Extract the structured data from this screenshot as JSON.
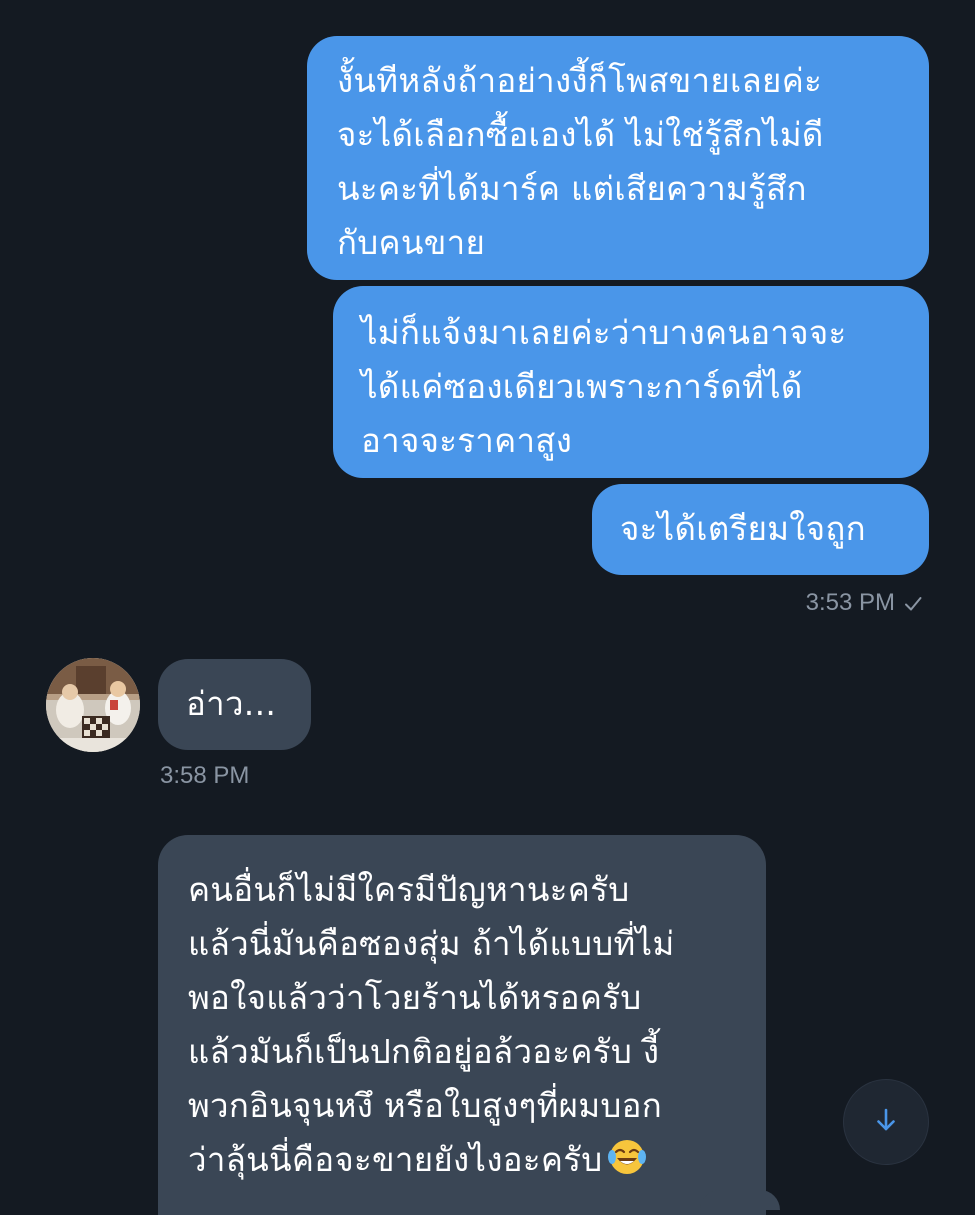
{
  "messages": [
    {
      "direction": "outgoing",
      "lines": [
        "งั้นทีหลังถ้าอย่างงี้ก็โพสขายเลยค่ะ",
        "จะได้เลือกซื้อเองได้ ไม่ใช่รู้สึกไม่ดี",
        "นะคะที่ได้มาร์ค แต่เสียความรู้สึก",
        "กับคนขาย"
      ]
    },
    {
      "direction": "outgoing",
      "lines": [
        "ไม่ก็แจ้งมาเลยค่ะว่าบางคนอาจจะ",
        "ได้แค่ซองเดียวเพราะการ์ดที่ได้",
        "อาจจะราคาสูง"
      ]
    },
    {
      "direction": "outgoing",
      "lines": [
        "จะได้เตรียมใจถูก"
      ]
    },
    {
      "direction": "incoming",
      "lines": [
        "อ่าว..."
      ]
    },
    {
      "direction": "incoming",
      "lines": [
        "คนอื่นก็ไม่มีใครมีปัญหานะครับ",
        "แล้วนี่มันคือซองสุ่ม ถ้าได้แบบที่ไม่",
        "พอใจแล้วว่าโวยร้านได้หรอครับ",
        "แล้วมันก็เป็นปกติอยู่อล้วอะครับ งี้",
        "พวกอินจุนหงึ หรือใบสูงๆที่ผมบอก",
        "ว่าลุ้นนี่คือจะขายยังไงอะครับ"
      ],
      "trailing_emoji": "face-with-tears-of-joy"
    }
  ],
  "timestamps": {
    "outgoing_group": "3:53 PM",
    "incoming_group": "3:58 PM"
  },
  "status": {
    "read_receipt": "check-icon"
  },
  "controls": {
    "scroll_down_icon": "arrow-down-icon"
  },
  "colors": {
    "background": "#141a22",
    "outgoing_bubble": "#4a96e9",
    "incoming_bubble": "#3a4655",
    "timestamp": "#8a95a3",
    "accent": "#4a96e9"
  }
}
